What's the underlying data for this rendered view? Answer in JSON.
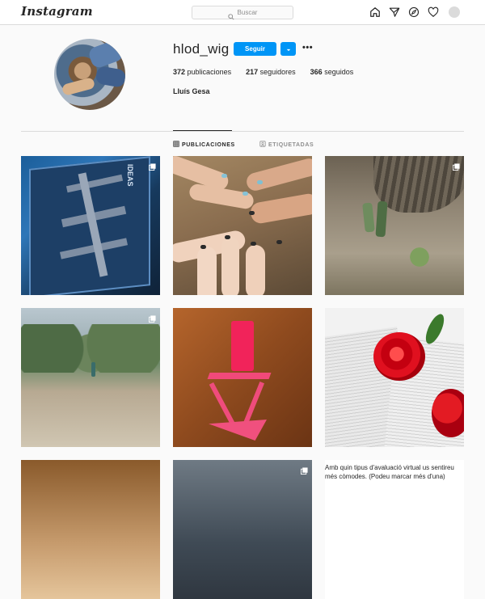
{
  "header": {
    "logo": "Instagram",
    "search_placeholder": "Buscar",
    "nav_icons": [
      "home-icon",
      "direct-icon",
      "explore-icon",
      "activity-heart-icon",
      "profile-avatar"
    ]
  },
  "profile": {
    "username": "hlod_wig",
    "follow_label": "Seguir",
    "more_label": "•••",
    "stats": {
      "posts_count": "372",
      "posts_label": "publicaciones",
      "followers_count": "217",
      "followers_label": "seguidores",
      "following_count": "366",
      "following_label": "seguidos"
    },
    "full_name": "Lluís Gesa"
  },
  "tabs": [
    {
      "label": "PUBLICACIONES",
      "active": true
    },
    {
      "label": "ETIQUETADAS",
      "active": false
    }
  ],
  "posts": [
    {
      "kind": "image",
      "subject": "space-station-box",
      "multi": true,
      "text": "IDEAS"
    },
    {
      "kind": "image",
      "subject": "painted-nails-hands",
      "multi": false
    },
    {
      "kind": "image",
      "subject": "bottles-by-tree",
      "multi": true
    },
    {
      "kind": "image",
      "subject": "forest-path",
      "multi": true
    },
    {
      "kind": "image",
      "subject": "pink-candle-stand",
      "multi": false
    },
    {
      "kind": "image",
      "subject": "rose-on-book",
      "multi": false
    },
    {
      "kind": "image",
      "subject": "partial-photo-1",
      "multi": false
    },
    {
      "kind": "image",
      "subject": "partial-photo-2",
      "multi": true
    },
    {
      "kind": "text",
      "text": "Amb quin tipus d'avaluació virtual us sentireu més còmodes. (Podeu marcar més d'una)"
    }
  ],
  "colors": {
    "accent": "#0095f6",
    "border": "#dbdbdb",
    "text": "#262626",
    "muted": "#8e8e8e"
  }
}
